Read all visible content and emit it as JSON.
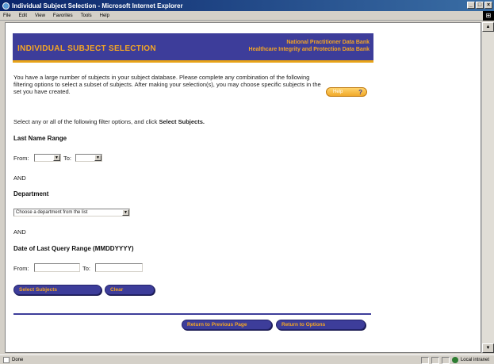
{
  "window": {
    "title": "Individual Subject Selection - Microsoft Internet Explorer",
    "controls": [
      "_",
      "□",
      "×"
    ]
  },
  "menu": [
    "File",
    "Edit",
    "View",
    "Favorites",
    "Tools",
    "Help"
  ],
  "header": {
    "title": "INDIVIDUAL SUBJECT SELECTION",
    "org_line1": "National Practitioner Data Bank",
    "org_line2": "Healthcare Integrity and Protection Data Bank"
  },
  "intro_text": "You have a large number of subjects in your subject database. Please complete any combination of the following filtering options to select a subset of subjects. After making your selection(s), you may choose specific subjects in the set you have created.",
  "help_button": {
    "label": "Help",
    "icon": "?"
  },
  "instruction": {
    "prefix": "Select any or all of the following filter options, and click ",
    "emphasis": "Select Subjects."
  },
  "last_name": {
    "heading": "Last Name Range",
    "from_label": "From:",
    "to_label": "To:",
    "from_value": "",
    "to_value": ""
  },
  "and1": "AND",
  "department": {
    "heading": "Department",
    "selected": "Choose a department from the list"
  },
  "and2": "AND",
  "date_range": {
    "heading": "Date of Last Query Range (MMDDYYYY)",
    "from_label": "From:",
    "to_label": "To:",
    "from_value": "",
    "to_value": ""
  },
  "buttons": {
    "select_subjects": "Select Subjects",
    "clear": "Clear",
    "return_previous": "Return to Previous Page",
    "return_options": "Return to Options"
  },
  "status": {
    "text": "Done",
    "zone": "Local intranet"
  },
  "colors": {
    "header_bg": "#3d3d9a",
    "accent_orange": "#f5a623",
    "title_bar": "#0a246a"
  }
}
